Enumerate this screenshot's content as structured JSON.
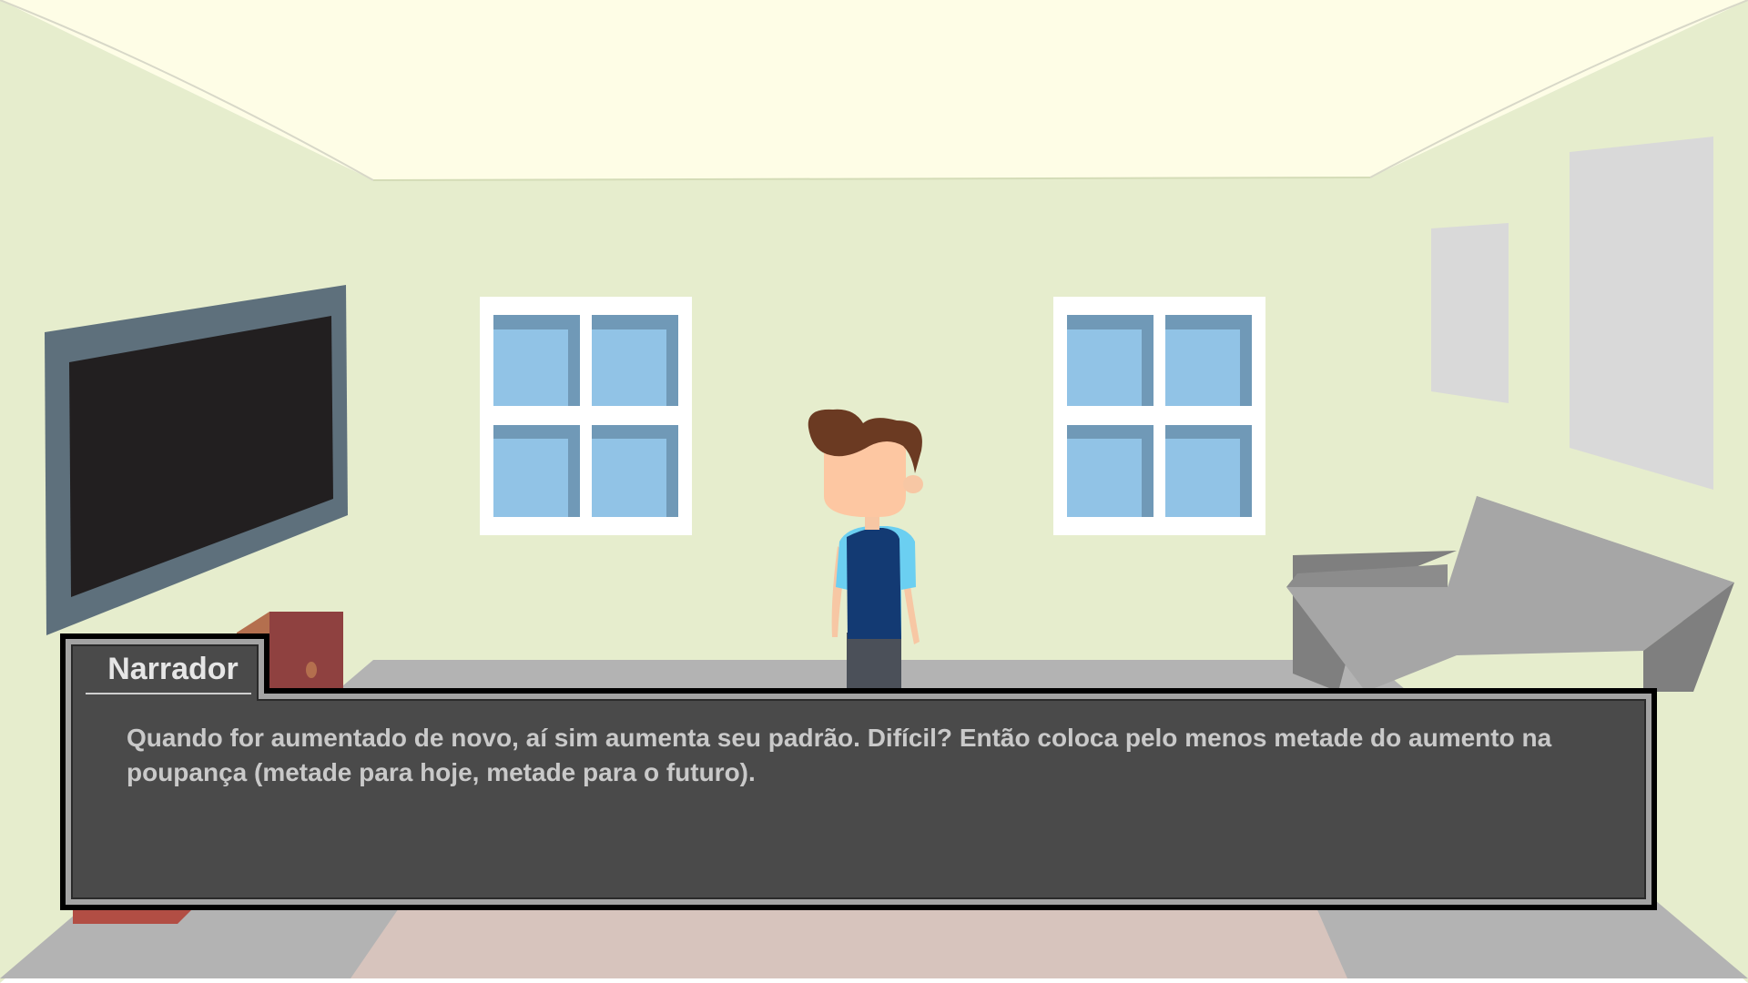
{
  "dialogue": {
    "speaker": "Narrador",
    "text": "Quando for aumentado de novo, aí sim aumenta seu padrão. Difícil? Então coloca pelo menos metade do aumento na poupança (metade para hoje, metade para o futuro)."
  },
  "colors": {
    "ceiling": "#fefde6",
    "wall": "#e6edcd",
    "floor": "#b3b3b3",
    "rug": "#d7c4bd",
    "window_frame": "#ffffff",
    "window_glass": "#91c3e6",
    "window_shade": "#7099b7",
    "tv_frame": "#5e707c",
    "tv_screen": "#221f20",
    "sofa": "#a6a6a6",
    "dialogue_bg": "#4a4a4a",
    "dialogue_border": "#a3a3a3"
  },
  "icons": {
    "character": "boy-character-icon",
    "tv": "television-icon",
    "sofa": "sofa-icon"
  }
}
